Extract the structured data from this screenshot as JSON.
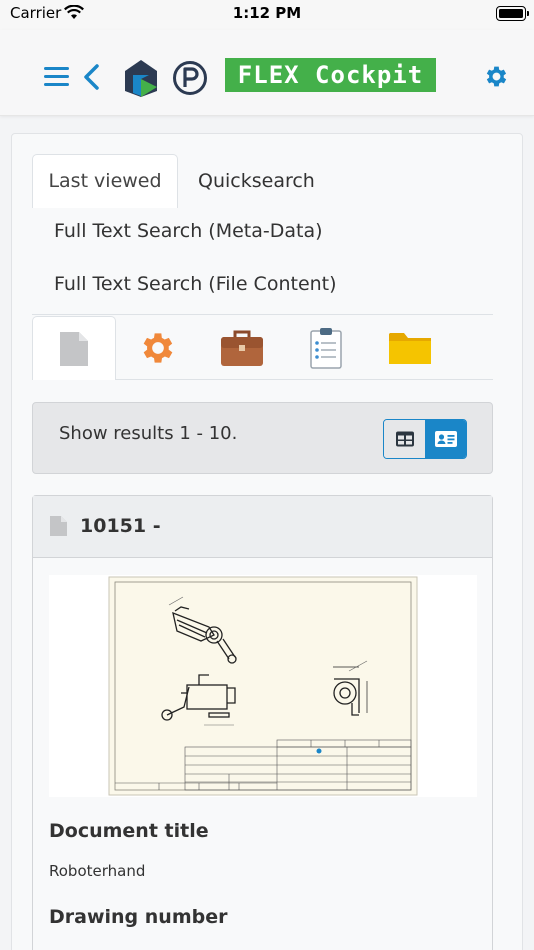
{
  "status_bar": {
    "carrier": "Carrier",
    "time": "1:12 PM"
  },
  "header": {
    "brand": "FLEX Cockpit",
    "accent_color": "#1a86c8",
    "brand_color": "#44b04a"
  },
  "search_tabs": [
    {
      "label": "Last viewed",
      "active": true
    },
    {
      "label": "Quicksearch",
      "active": false
    },
    {
      "label": "Full Text Search (Meta-Data)",
      "active": false
    },
    {
      "label": "Full Text Search (File Content)",
      "active": false
    }
  ],
  "category_tabs": [
    {
      "icon": "document-icon",
      "active": true
    },
    {
      "icon": "gear-icon",
      "active": false
    },
    {
      "icon": "briefcase-icon",
      "active": false
    },
    {
      "icon": "clipboard-icon",
      "active": false
    },
    {
      "icon": "folder-icon",
      "active": false
    }
  ],
  "results": {
    "summary": "Show results 1 - 10.",
    "view_mode": "card"
  },
  "result_item": {
    "title": "10151 -",
    "fields": [
      {
        "label": "Document title",
        "value": "Roboterhand"
      },
      {
        "label": "Drawing number",
        "value": ""
      }
    ]
  }
}
